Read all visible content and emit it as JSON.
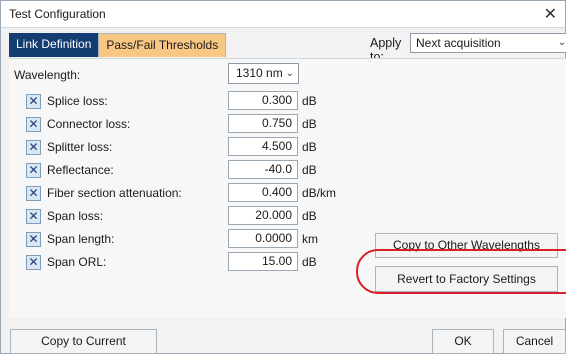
{
  "window": {
    "title": "Test Configuration",
    "close_glyph": "✕"
  },
  "tabs": [
    {
      "label": "Link Definition",
      "active": false
    },
    {
      "label": "Pass/Fail Thresholds",
      "active": true
    }
  ],
  "apply_to": {
    "label": "Apply to:",
    "value": "Next acquisition"
  },
  "wavelength": {
    "label": "Wavelength:",
    "value": "1310 nm"
  },
  "thresholds": [
    {
      "label": "Splice loss:",
      "value": "0.300",
      "unit": "dB",
      "checked": true
    },
    {
      "label": "Connector loss:",
      "value": "0.750",
      "unit": "dB",
      "checked": true
    },
    {
      "label": "Splitter loss:",
      "value": "4.500",
      "unit": "dB",
      "checked": true
    },
    {
      "label": "Reflectance:",
      "value": "-40.0",
      "unit": "dB",
      "checked": true
    },
    {
      "label": "Fiber section attenuation:",
      "value": "0.400",
      "unit": "dB/km",
      "checked": true
    },
    {
      "label": "Span loss:",
      "value": "20.000",
      "unit": "dB",
      "checked": true
    },
    {
      "label": "Span length:",
      "value": "0.0000",
      "unit": "km",
      "checked": true
    },
    {
      "label": "Span ORL:",
      "value": "15.00",
      "unit": "dB",
      "checked": true
    }
  ],
  "checkbox_glyph": "✕",
  "buttons": {
    "copy_wavelengths": "Copy to Other Wavelengths",
    "revert": "Revert to Factory Settings",
    "copy_current": "Copy to Current Acquisition",
    "ok": "OK",
    "cancel": "Cancel"
  },
  "colors": {
    "tab_inactive": "#133c73",
    "tab_active": "#f9c784",
    "highlight": "#d81f2a"
  }
}
